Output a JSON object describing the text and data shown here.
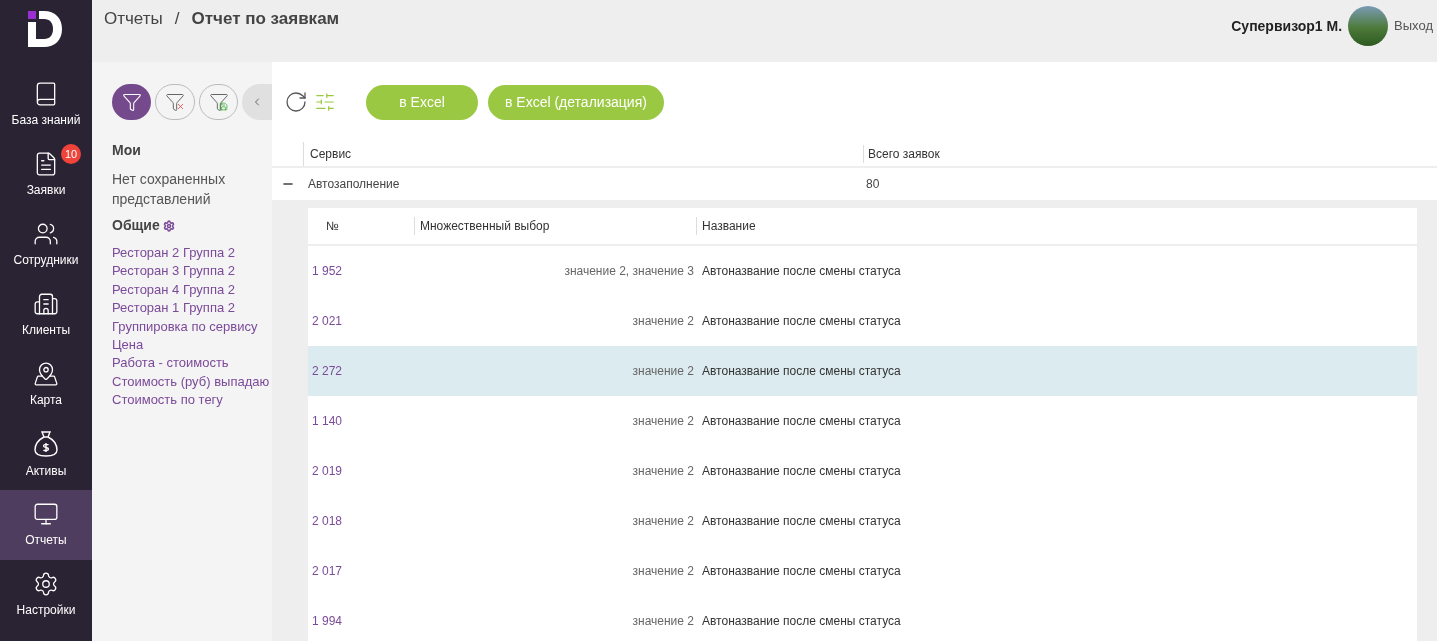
{
  "breadcrumb": {
    "parent": "Отчеты",
    "separator": "/",
    "current": "Отчет по заявкам"
  },
  "user": {
    "name": "Супервизор1 М.",
    "logout": "Выход"
  },
  "nav": [
    {
      "kind": "book",
      "label": "База знаний",
      "selected": false
    },
    {
      "kind": "doc",
      "label": "Заявки",
      "selected": false,
      "badge": "10"
    },
    {
      "kind": "people",
      "label": "Сотрудники",
      "selected": false
    },
    {
      "kind": "city",
      "label": "Клиенты",
      "selected": false
    },
    {
      "kind": "map",
      "label": "Карта",
      "selected": false
    },
    {
      "kind": "money",
      "label": "Активы",
      "selected": false
    },
    {
      "kind": "monitor",
      "label": "Отчеты",
      "selected": true
    },
    {
      "kind": "gear",
      "label": "Настройки",
      "selected": false
    }
  ],
  "views": {
    "mine_title": "Мои",
    "mine_empty": "Нет сохраненных представлений",
    "shared_title": "Общие",
    "shared": [
      "Ресторан 2 Группа 2",
      "Ресторан 3 Группа 2",
      "Ресторан 4 Группа 2",
      "Ресторан 1 Группа 2",
      "Группировка по сервису",
      "Цена",
      "Работа - стоимость",
      "Стоимость (руб) выпадаю",
      "Стоимость по тегу"
    ]
  },
  "buttons": [
    "в Excel",
    "в Excel (детализация)"
  ],
  "group_table": {
    "columns": [
      "Сервис",
      "Всего заявок"
    ],
    "group": {
      "name": "Автозаполнение",
      "count": "80",
      "expanded": true
    }
  },
  "detail_table": {
    "columns": [
      "№",
      "Множественный выбор",
      "Название"
    ],
    "rows": [
      {
        "number": "1 952",
        "choice": "значение 2, значение 3",
        "title": "Автоназвание после смены статуса",
        "selected": false
      },
      {
        "number": "2 021",
        "choice": "значение 2",
        "title": "Автоназвание после смены статуса",
        "selected": false
      },
      {
        "number": "2 272",
        "choice": "значение 2",
        "title": "Автоназвание после смены статуса",
        "selected": true
      },
      {
        "number": "1 140",
        "choice": "значение 2",
        "title": "Автоназвание после смены статуса",
        "selected": false
      },
      {
        "number": "2 019",
        "choice": "значение 2",
        "title": "Автоназвание после смены статуса",
        "selected": false
      },
      {
        "number": "2 018",
        "choice": "значение 2",
        "title": "Автоназвание после смены статуса",
        "selected": false
      },
      {
        "number": "2 017",
        "choice": "значение 2",
        "title": "Автоназвание после смены статуса",
        "selected": false
      },
      {
        "number": "1 994",
        "choice": "значение 2",
        "title": "Автоназвание после смены статуса",
        "selected": false
      }
    ]
  }
}
